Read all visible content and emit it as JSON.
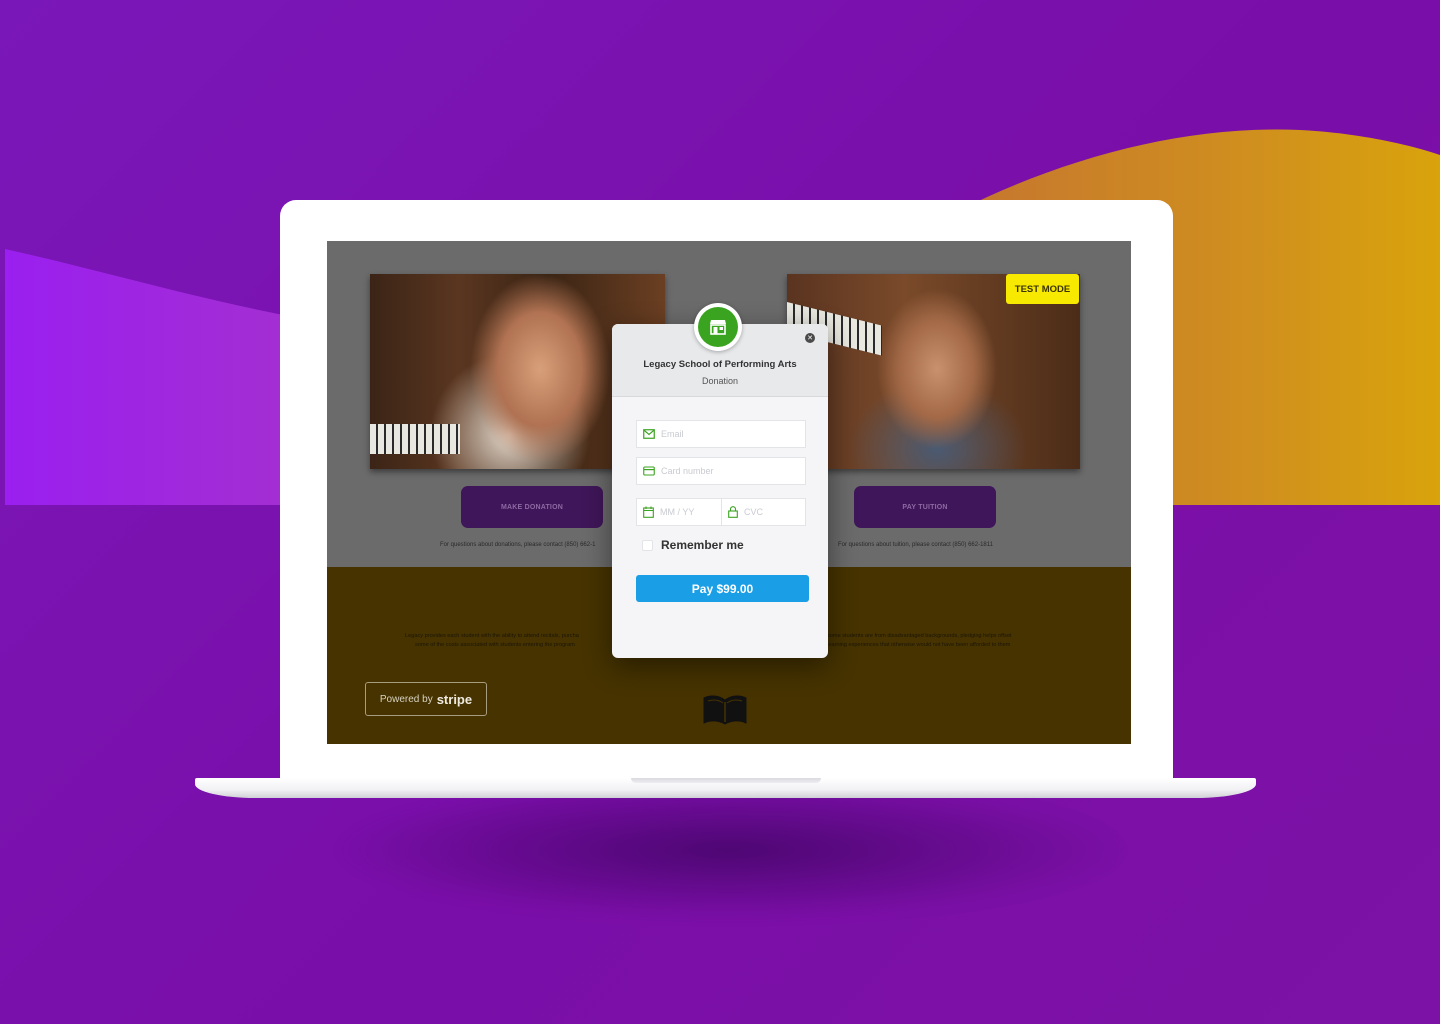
{
  "colors": {
    "background": "#7a12b0",
    "accent_orange": "#d9a010",
    "pay_button": "#1a9ee6",
    "test_mode_badge": "#f7ea00",
    "merchant_icon": "#3aa320"
  },
  "site": {
    "left_card": {
      "button_label": "MAKE DONATION",
      "contact_text": "For questions about donations, please contact (850) 662-1"
    },
    "right_card": {
      "button_label": "PAY TUITION",
      "contact_text": "For questions about tuition, please contact (850) 662-1811"
    },
    "about": {
      "left_line1": "Legacy provides each student with the ability to attend recitals, purcha",
      "left_line2": "some of the costs associated with students entering the program",
      "right_line1": "some students are from disadvantaged backgrounds, pledging helps offset",
      "right_line2": "learning experiences that otherwise would not have been afforded to them"
    },
    "test_mode_label": "TEST MODE",
    "powered_by": {
      "prefix": "Powered by",
      "brand": "stripe"
    },
    "book_icon": "open-book-icon"
  },
  "checkout": {
    "merchant_name": "Legacy School of Performing Arts",
    "description": "Donation",
    "merchant_icon": "storefront-icon",
    "close_icon": "close-icon",
    "email": {
      "placeholder": "Email",
      "icon": "envelope-icon"
    },
    "card_number": {
      "placeholder": "Card number",
      "icon": "credit-card-icon"
    },
    "expiry": {
      "placeholder": "MM / YY",
      "icon": "calendar-icon"
    },
    "cvc": {
      "placeholder": "CVC",
      "icon": "lock-icon"
    },
    "remember_label": "Remember me",
    "pay_label": "Pay $99.00"
  }
}
